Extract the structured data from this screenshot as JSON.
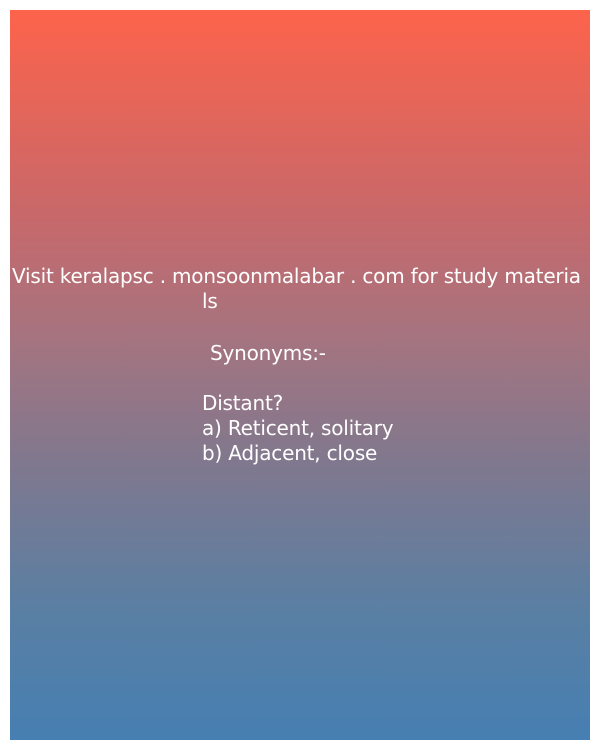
{
  "post": {
    "promo_line": "Visit keralapsc . monsoonmalabar . com for study materia",
    "promo_wrap": "ls",
    "heading": "Synonyms:-",
    "question": "Distant?",
    "options": [
      "a) Reticent, solitary",
      "b) Adjacent, close"
    ]
  },
  "colors": {
    "gradient_top": "#fd634b",
    "gradient_bottom": "#467fb2",
    "text": "#ffffff"
  }
}
